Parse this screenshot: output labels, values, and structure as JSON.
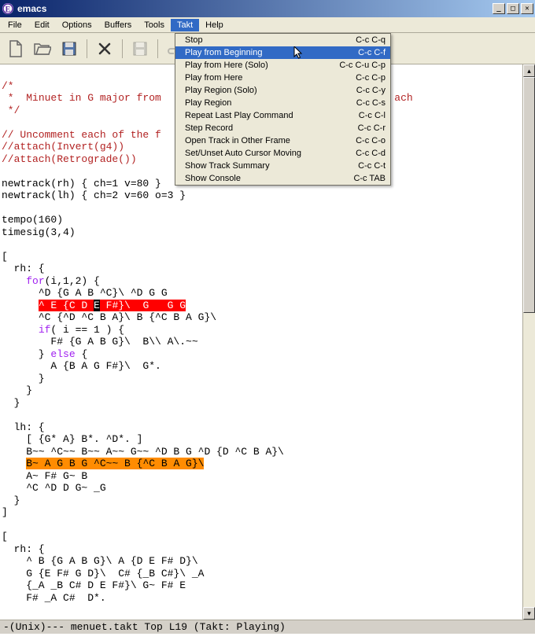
{
  "window": {
    "title": "emacs"
  },
  "menubar": [
    "File",
    "Edit",
    "Options",
    "Buffers",
    "Tools",
    "Takt",
    "Help"
  ],
  "menubar_open_index": 5,
  "dropdown": {
    "items": [
      {
        "label": "Stop",
        "shortcut": "C-c C-q"
      },
      {
        "label": "Play from Beginning",
        "shortcut": "C-c C-f",
        "highlighted": true
      },
      {
        "label": "Play from Here (Solo)",
        "shortcut": "C-c C-u C-p"
      },
      {
        "label": "Play from Here",
        "shortcut": "C-c C-p"
      },
      {
        "label": "Play Region (Solo)",
        "shortcut": "C-c C-y"
      },
      {
        "label": "Play Region",
        "shortcut": "C-c C-s"
      },
      {
        "label": "Repeat Last Play Command",
        "shortcut": "C-c C-l"
      },
      {
        "label": "Step Record",
        "shortcut": "C-c C-r"
      },
      {
        "label": "Open Track in Other Frame",
        "shortcut": "C-c C-o"
      },
      {
        "label": "Set/Unset Auto Cursor Moving",
        "shortcut": "C-c C-d"
      },
      {
        "label": "Show Track Summary",
        "shortcut": "C-c C-t"
      },
      {
        "label": "Show Console",
        "shortcut": "C-c TAB"
      }
    ]
  },
  "toolbar_icons": [
    "new-file",
    "open-file",
    "save-file",
    "close",
    "save-disk",
    "undo"
  ],
  "editor": {
    "comment1_l1": "/*",
    "comment1_l2": " *",
    "comment1_l2_after": "  Minuet in G major from",
    "comment1_l2_tail": "ach",
    "comment1_l3": " */",
    "comment2": "// Uncomment each of the f",
    "comment3": "//attach(Invert(g4))",
    "comment4": "//attach(Retrograde())",
    "newtrack_rh_a": "newtrack(rh) { ch=1 v=80 }",
    "newtrack_lh_a": "newtrack(lh) { ch=2 v=60 o=3 }",
    "tempo": "tempo(160)",
    "timesig": "timesig(3,4)",
    "lbrack1": "[",
    "rh_open": "  rh: {",
    "for_open_a": "    ",
    "for_kw": "for",
    "for_open_b": "(i,1,2) {",
    "rhL1": "      ^D {G A B ^C}\\ ^D G G",
    "rhL2_pre": "      ",
    "rhL2a": "^ E {C D ",
    "rhL2_cursor": "E",
    "rhL2b": " F#}\\  G   G G",
    "rhL3": "      ^C {^D ^C B A}\\ B {^C B A G}\\",
    "if_a": "      ",
    "if_kw": "if",
    "if_b": "( i == 1 ) {",
    "rhL4": "        F# {G A B G}\\  B\\\\ A\\.~~",
    "else_a": "      } ",
    "else_kw": "else",
    "else_b": " {",
    "rhL5": "        A {B A G F#}\\  G*.",
    "rhClose1": "      }",
    "rhClose2": "    }",
    "rhClose3": "  }",
    "blank": "",
    "lh_open": "  lh: {",
    "lhL1": "    [ {G* A} B*. ^D*. ]",
    "lhL2": "    B~~ ^C~~ B~~ A~~ G~~ ^D B G ^D {D ^C B A}\\",
    "lhL3_pre": "    ",
    "lhL3_hl": "B~ A G B G ^C~~ B {^C B A G}\\",
    "lhL4": "    A~ F# G~ B",
    "lhL5": "    ^C ^D D G~ _G",
    "lhClose": "  }",
    "rbrack1": "]",
    "lbrack2": "[",
    "rh2_open": "  rh: {",
    "rh2L1": "    ^ B {G A B G}\\ A {D E F# D}\\",
    "rh2L2": "    G {E F# G D}\\  C# {_B C#}\\ _A",
    "rh2L3": "    {_A _B C# D E F#}\\ G~ F# E",
    "rh2L4": "    F# _A C#  D*."
  },
  "modeline": "-(Unix)---  menuet.takt    Top L19    (Takt: Playing)"
}
